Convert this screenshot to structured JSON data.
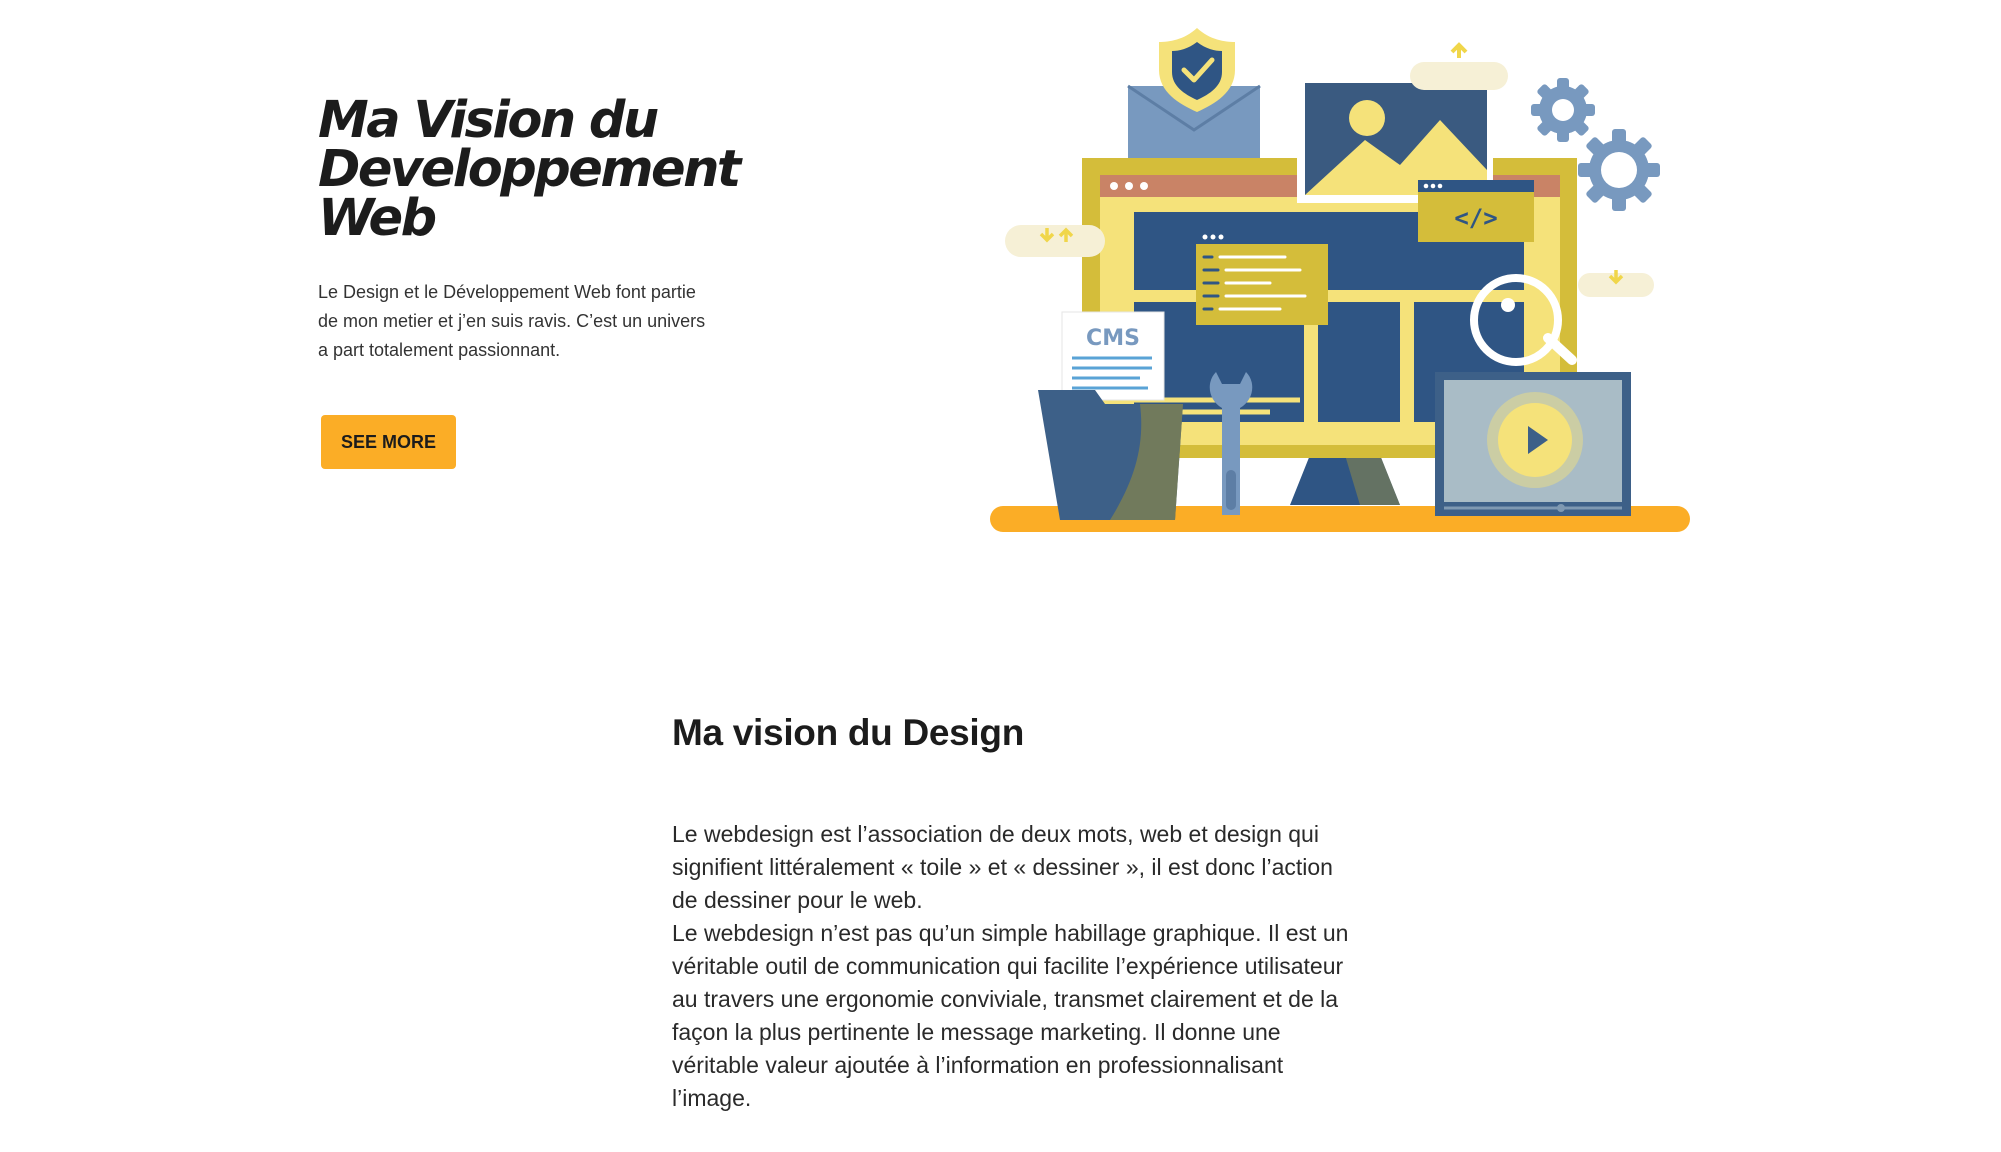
{
  "hero": {
    "title_line1": "Ma Vision du",
    "title_line2": "Developpement",
    "title_line3": "Web",
    "description": "Le Design et le Développement Web font partie de mon metier et j’en suis ravis. C’est un univers a part totalement passionnant.",
    "button_label": "SEE MORE"
  },
  "illustration": {
    "cms_label": "CMS",
    "code_label": "</>"
  },
  "design_section": {
    "title": "Ma vision du Design",
    "paragraph1": "Le webdesign est l’association de deux mots, web et design qui signifient littéralement « toile » et « dessiner », il est donc l’action de dessiner pour le web.",
    "paragraph2": "Le webdesign n’est pas qu’un simple habillage graphique. Il est un véritable outil de communication qui facilite l’expérience utilisateur au travers une ergonomie conviviale, transmet clairement et de la façon la plus pertinente le message marketing. Il donne une véritable valeur ajoutée à l’information en professionnalisant l’image."
  },
  "colors": {
    "accent": "#fbad26",
    "navy": "#2f5584",
    "yellow": "#f5e27a",
    "olive": "#d4bd3a",
    "steel_blue": "#7899bf",
    "text": "#1c1c1c"
  }
}
